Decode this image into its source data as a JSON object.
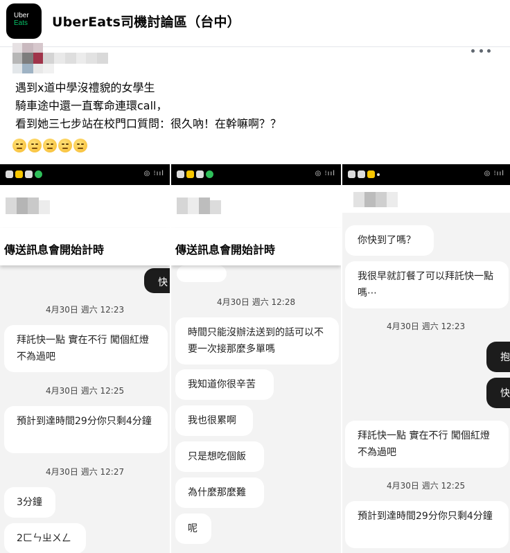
{
  "group": {
    "logo_line1": "Uber",
    "logo_line2": "Eats",
    "title": "UberEats司機討論區（台中）"
  },
  "post": {
    "lines": [
      "遇到x道中學沒禮貌的女學生",
      "騎車途中還一直奪命連環call，",
      "看到她三七步站在校門口質問：很久吶！在幹嘛啊？？"
    ],
    "emoji_count": 5,
    "emoji_name": "face-with-rolling-eyes"
  },
  "screenshots": [
    {
      "timer_banner": "傳送訊息會開始計時",
      "status_right": "◎ ⁝ııl",
      "outgoing_partial": [
        "快"
      ],
      "stamps": [
        "4月30日 週六 12:23",
        "4月30日 週六 12:25",
        "4月30日 週六 12:27"
      ],
      "messages": [
        "拜託快一點 實在不行 闖個紅燈不為過吧",
        "預計到達時間29分你只剩4分鐘",
        "3分鐘",
        "2ㄈㄣㄓㄨㄥ"
      ]
    },
    {
      "timer_banner": "傳送訊息會開始計時",
      "status_right": "◎ ⁝ııl",
      "stamps": [
        "4月30日 週六 12:28"
      ],
      "messages": [
        "時間只能沒辦法送到的話可以不要一次接那麼多單嗎",
        "我知道你很辛苦",
        "我也很累啊",
        "只是想吃個飯",
        "為什麼那麼難",
        "呢"
      ]
    },
    {
      "status_right": "◎ ⁝ııl",
      "outgoing_partial": [
        "抱",
        "快"
      ],
      "stamps": [
        "4月30日 週六 12:23",
        "4月30日 週六 12:25"
      ],
      "messages": [
        "你快到了嗎？",
        "我很早就訂餐了可以拜託快一點嗎⋯",
        "拜託快一點 實在不行 闖個紅燈不為過吧",
        "預計到達時間29分你只剩4分鐘"
      ]
    }
  ],
  "colors": {
    "status_bar": "#000000",
    "chat_background": "#f3f3f3",
    "bubble_incoming": "#ffffff",
    "bubble_outgoing": "#1c1c1c",
    "brand_green": "#06c167"
  }
}
